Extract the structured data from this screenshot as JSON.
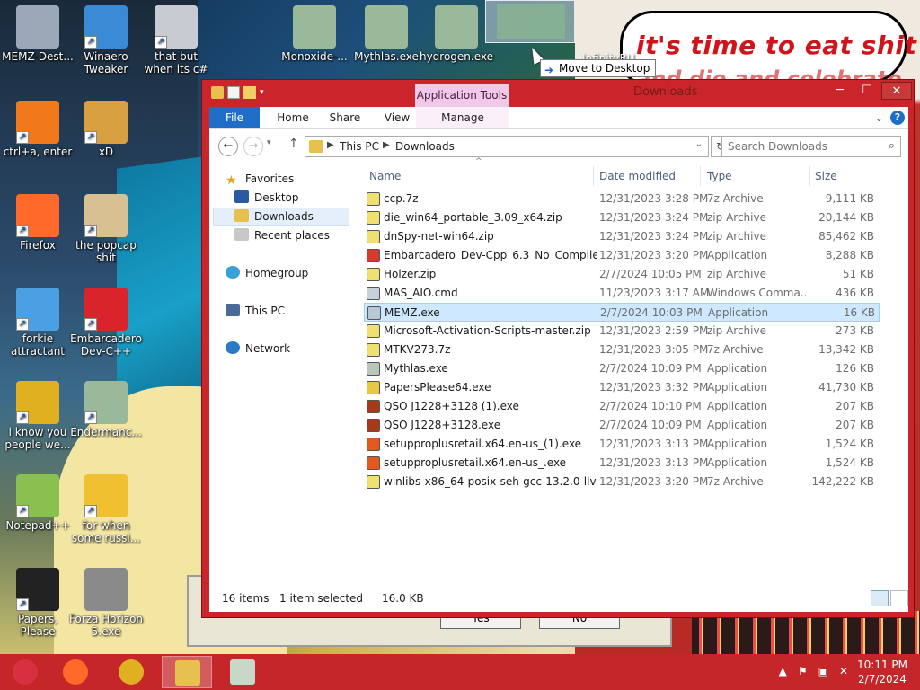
{
  "wallpaper": {
    "caption": "it's time to eat shit",
    "caption2": "and die and celebrate"
  },
  "desktop_icons": [
    {
      "label": "MEMZ-Dest...",
      "icon": "recycle-bin-icon",
      "color": "#9aa8b8",
      "shortcut": false
    },
    {
      "label": "Winaero Tweaker",
      "icon": "winaero-icon",
      "color": "#3a8ad6",
      "shortcut": true
    },
    {
      "label": "that but when its c#",
      "icon": "stacked-windows-icon",
      "color": "#c8ccd2",
      "shortcut": true
    },
    {
      "label": "Monoxide-...",
      "icon": "app-window-icon",
      "color": "#9ab89a",
      "shortcut": false
    },
    {
      "label": "Mythlas.exe",
      "icon": "app-window-icon",
      "color": "#9ab89a",
      "shortcut": false
    },
    {
      "label": "hydrogen.exe",
      "icon": "app-window-shield-icon",
      "color": "#9ab89a",
      "shortcut": false
    },
    {
      "label": "ctrl+a, enter",
      "icon": "ring-icon",
      "color": "#f07a1a",
      "shortcut": true
    },
    {
      "label": "xD",
      "icon": "hxd-icon",
      "color": "#d8a040",
      "shortcut": true
    },
    {
      "label": "Firefox",
      "icon": "firefox-icon",
      "color": "#ff6a2a",
      "shortcut": true
    },
    {
      "label": "the popcap shit",
      "icon": "music-file-icon",
      "color": "#d8c090",
      "shortcut": true
    },
    {
      "label": "forkie attractant",
      "icon": "gear-window-icon",
      "color": "#4aa0e0",
      "shortcut": true
    },
    {
      "label": "Embarcadero Dev-C++",
      "icon": "devcpp-icon",
      "color": "#d8242a",
      "shortcut": true
    },
    {
      "label": "i know you people we...",
      "icon": "chrome-icon",
      "color": "#e0b020",
      "shortcut": true
    },
    {
      "label": "Endermanc...",
      "icon": "app-window-icon",
      "color": "#9ab89a",
      "shortcut": true
    },
    {
      "label": "Notepad++",
      "icon": "notepadpp-icon",
      "color": "#8ac050",
      "shortcut": true
    },
    {
      "label": "for when some russi...",
      "icon": "de-icon",
      "color": "#f0c030",
      "shortcut": true
    },
    {
      "label": "Papers, Please",
      "icon": "papers-please-icon",
      "color": "#222222",
      "shortcut": true
    },
    {
      "label": "Forza Horizon 5.exe",
      "icon": "flash-icon",
      "color": "#8a8a8a",
      "shortcut": false
    }
  ],
  "drag": {
    "tooltip": "Move to Desktop",
    "partial_label": "InfinityRU"
  },
  "window": {
    "title": "Downloads",
    "context_tab": "Application Tools",
    "ribbon_tabs": [
      "File",
      "Home",
      "Share",
      "View",
      "Manage"
    ],
    "breadcrumb": [
      "This PC",
      "Downloads"
    ],
    "search_placeholder": "Search Downloads",
    "nav": {
      "favorites": "Favorites",
      "desktop": "Desktop",
      "downloads": "Downloads",
      "recent": "Recent places",
      "homegroup": "Homegroup",
      "thispc": "This PC",
      "network": "Network"
    },
    "columns": [
      "Name",
      "Date modified",
      "Type",
      "Size"
    ],
    "files": [
      {
        "name": "ccp.7z",
        "date": "12/31/2023 3:28 PM",
        "type": "7z Archive",
        "size": "9,111 KB",
        "icon": "archive-icon",
        "color": "#f0e070"
      },
      {
        "name": "die_win64_portable_3.09_x64.zip",
        "date": "12/31/2023 3:24 PM",
        "type": "zip Archive",
        "size": "20,144 KB",
        "icon": "archive-icon",
        "color": "#f0e070"
      },
      {
        "name": "dnSpy-net-win64.zip",
        "date": "12/31/2023 3:24 PM",
        "type": "zip Archive",
        "size": "85,462 KB",
        "icon": "archive-icon",
        "color": "#f0e070"
      },
      {
        "name": "Embarcadero_Dev-Cpp_6.3_No_Compiler...",
        "date": "12/31/2023 3:20 PM",
        "type": "Application",
        "size": "8,288 KB",
        "icon": "installer-icon",
        "color": "#d83a2a"
      },
      {
        "name": "Holzer.zip",
        "date": "2/7/2024 10:05 PM",
        "type": "zip Archive",
        "size": "51 KB",
        "icon": "archive-icon",
        "color": "#f0e070"
      },
      {
        "name": "MAS_AIO.cmd",
        "date": "11/23/2023 3:17 AM",
        "type": "Windows Comma...",
        "size": "436 KB",
        "icon": "cmd-icon",
        "color": "#c8d0d8"
      },
      {
        "name": "MEMZ.exe",
        "date": "2/7/2024 10:03 PM",
        "type": "Application",
        "size": "16 KB",
        "icon": "exe-icon",
        "color": "#b8c8d8",
        "selected": true
      },
      {
        "name": "Microsoft-Activation-Scripts-master.zip",
        "date": "12/31/2023 2:59 PM",
        "type": "zip Archive",
        "size": "273 KB",
        "icon": "archive-icon",
        "color": "#f0e070"
      },
      {
        "name": "MTKV273.7z",
        "date": "12/31/2023 3:05 PM",
        "type": "7z Archive",
        "size": "13,342 KB",
        "icon": "archive-icon",
        "color": "#f0e070"
      },
      {
        "name": "Mythlas.exe",
        "date": "2/7/2024 10:09 PM",
        "type": "Application",
        "size": "126 KB",
        "icon": "exe-icon",
        "color": "#b8c8b8"
      },
      {
        "name": "PapersPlease64.exe",
        "date": "12/31/2023 3:32 PM",
        "type": "Application",
        "size": "41,730 KB",
        "icon": "exe-icon",
        "color": "#e8c840"
      },
      {
        "name": "QSO J1228+3128 (1).exe",
        "date": "2/7/2024 10:10 PM",
        "type": "Application",
        "size": "207 KB",
        "icon": "exe-icon",
        "color": "#a83a1a"
      },
      {
        "name": "QSO J1228+3128.exe",
        "date": "2/7/2024 10:09 PM",
        "type": "Application",
        "size": "207 KB",
        "icon": "exe-icon",
        "color": "#a83a1a"
      },
      {
        "name": "setupproplusretail.x64.en-us_(1).exe",
        "date": "12/31/2023 3:13 PM",
        "type": "Application",
        "size": "1,524 KB",
        "icon": "office-icon",
        "color": "#e05a20"
      },
      {
        "name": "setupproplusretail.x64.en-us_.exe",
        "date": "12/31/2023 3:13 PM",
        "type": "Application",
        "size": "1,524 KB",
        "icon": "office-icon",
        "color": "#e05a20"
      },
      {
        "name": "winlibs-x86_64-posix-seh-gcc-13.2.0-llv...",
        "date": "12/31/2023 3:20 PM",
        "type": "7z Archive",
        "size": "142,222 KB",
        "icon": "archive-icon",
        "color": "#f0e070"
      }
    ],
    "status": {
      "count": "16 items",
      "selection": "1 item selected",
      "size": "16.0 KB"
    }
  },
  "background_dialog": {
    "yes": "Yes",
    "no": "No"
  },
  "taskbar": {
    "items": [
      {
        "icon": "start-orb-icon",
        "color": "#d83040"
      },
      {
        "icon": "firefox-icon",
        "color": "#ff6a2a"
      },
      {
        "icon": "chrome-icon",
        "color": "#e0b020"
      },
      {
        "icon": "file-explorer-icon",
        "color": "#e8c050",
        "active": true
      },
      {
        "icon": "app-window-icon",
        "color": "#c8d8c8"
      }
    ],
    "time": "10:11 PM",
    "date": "2/7/2024"
  }
}
